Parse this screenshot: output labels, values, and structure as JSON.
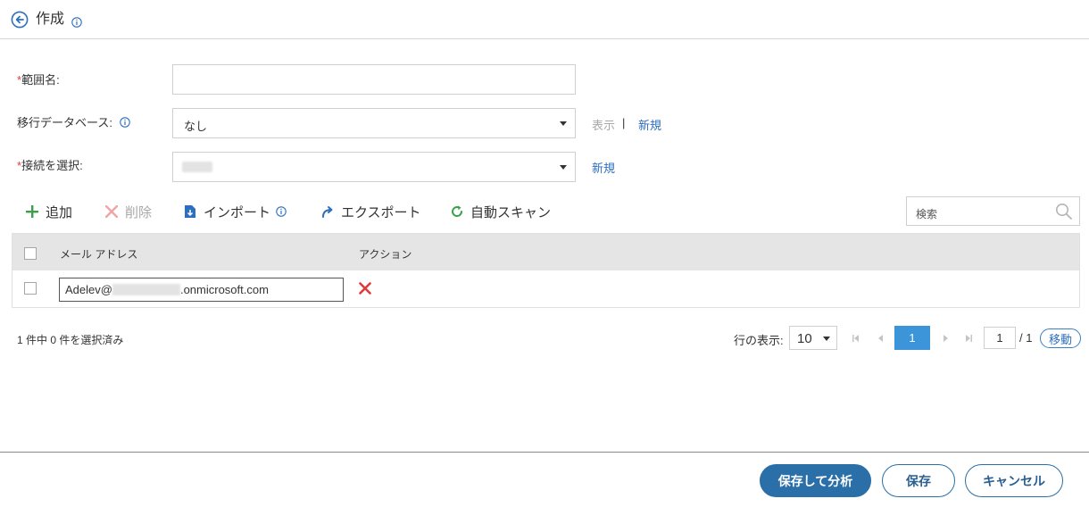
{
  "header": {
    "title": "作成"
  },
  "form": {
    "scope_name": {
      "required_mark": "*",
      "label": "範囲名:",
      "value": ""
    },
    "migration_db": {
      "label": "移行データベース:",
      "value": "なし",
      "show_link": "表示",
      "separator": "|",
      "new_link": "新規"
    },
    "connection": {
      "required_mark": "*",
      "label": "接続を選択:",
      "new_link": "新規"
    }
  },
  "toolbar": {
    "add": "追加",
    "delete": "削除",
    "import": "インポート",
    "export": "エクスポート",
    "auto_scan": "自動スキャン",
    "search_placeholder": "検索"
  },
  "table": {
    "columns": {
      "email": "メール アドレス",
      "action": "アクション"
    },
    "rows": [
      {
        "email_prefix": "Adelev@",
        "email_suffix": ".onmicrosoft.com"
      }
    ]
  },
  "status": {
    "selection": "1 件中 0 件を選択済み"
  },
  "pagination": {
    "rows_label": "行の表示:",
    "rows_per_page": "10",
    "current_page": "1",
    "page_input": "1",
    "total": "/ 1",
    "go_button": "移動"
  },
  "footer": {
    "save_analyze": "保存して分析",
    "save": "保存",
    "cancel": "キャンセル"
  },
  "colors": {
    "accent": "#2a6fa8",
    "link": "#2c6fbf",
    "required": "#e03a3a",
    "add_icon": "#3aa04a",
    "delete_icon": "#e03a3a"
  },
  "icons": [
    "back-arrow-icon",
    "info-icon",
    "plus-icon",
    "x-icon",
    "import-icon",
    "export-arrow-icon",
    "refresh-icon",
    "search-icon",
    "chevron-down-icon"
  ]
}
